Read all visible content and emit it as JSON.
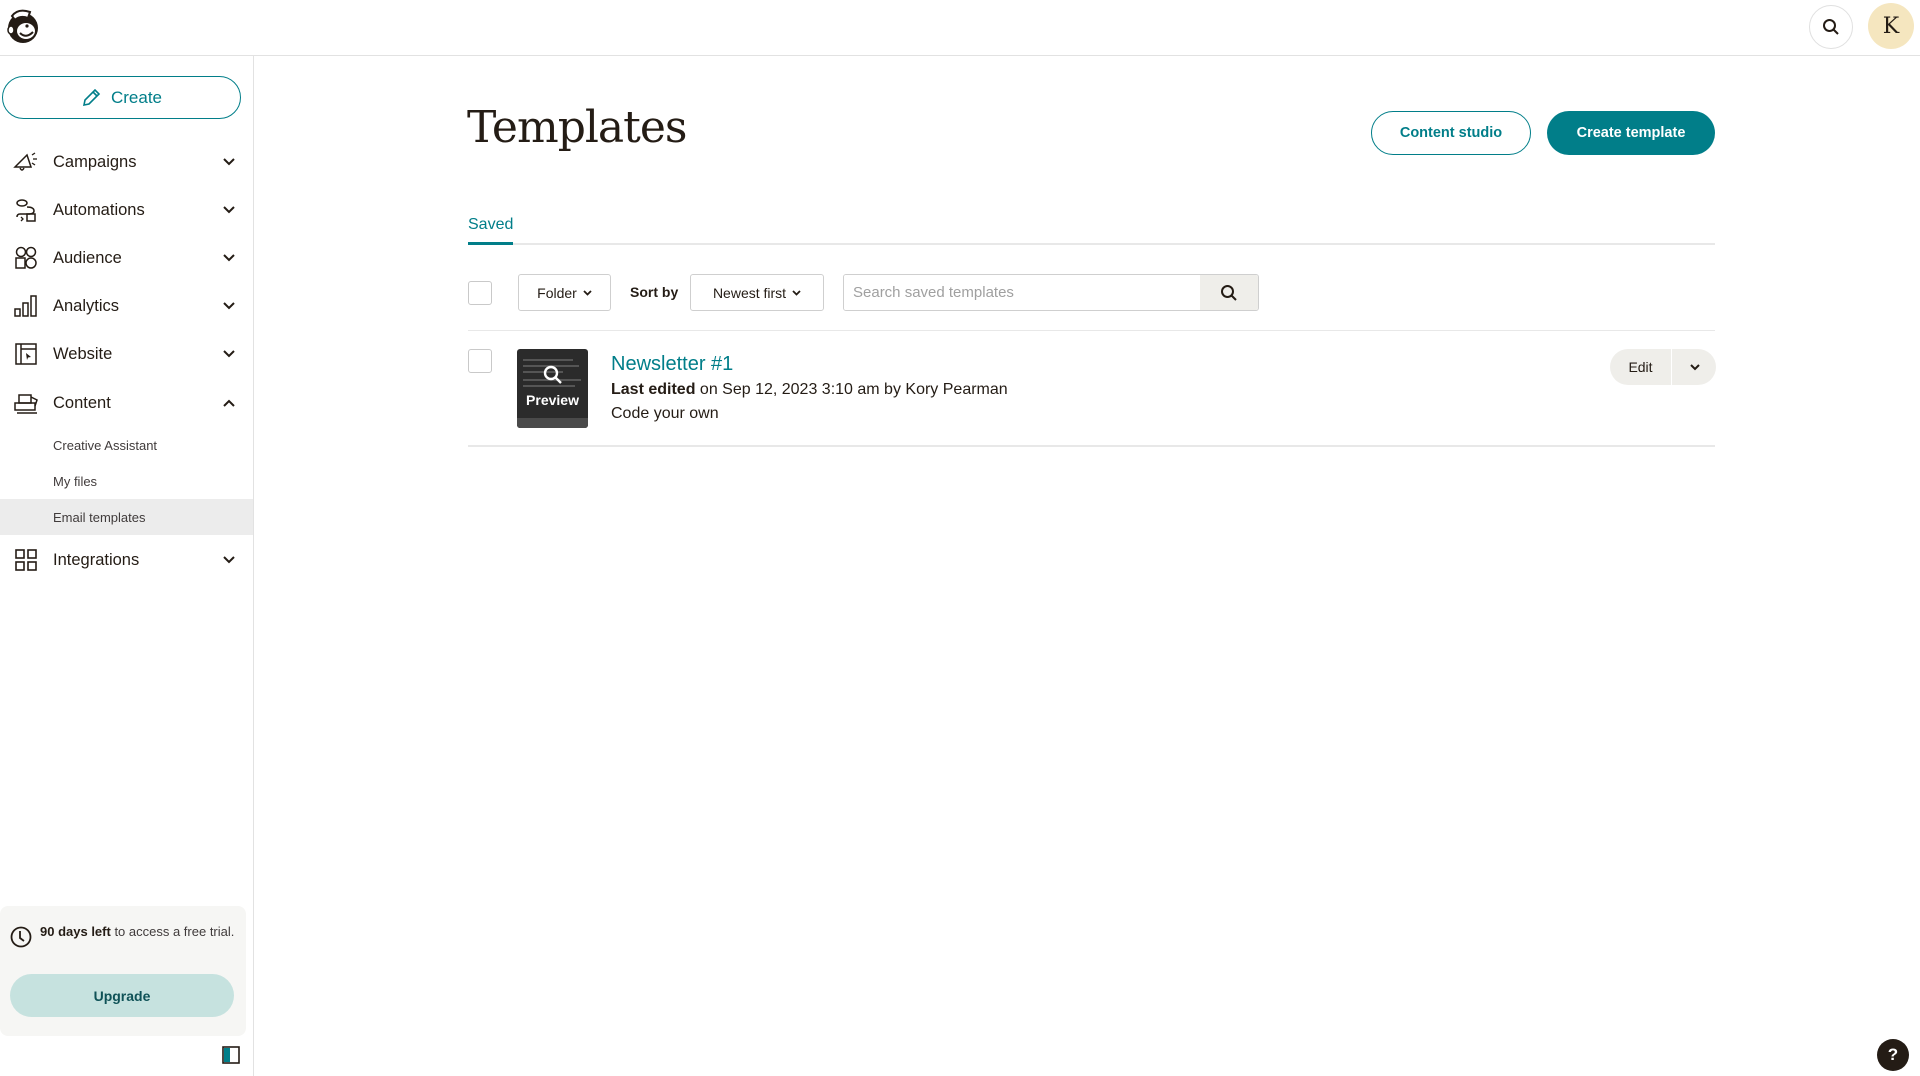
{
  "header": {
    "logo": "mailchimp-freddie-logo",
    "search_icon": "search-icon",
    "avatar_initial": "K"
  },
  "sidebar": {
    "create_label": "Create",
    "nav": [
      {
        "label": "Campaigns",
        "icon": "megaphone-icon",
        "expanded": false
      },
      {
        "label": "Automations",
        "icon": "automation-flow-icon",
        "expanded": false
      },
      {
        "label": "Audience",
        "icon": "audience-icon",
        "expanded": false
      },
      {
        "label": "Analytics",
        "icon": "bar-chart-icon",
        "expanded": false
      },
      {
        "label": "Website",
        "icon": "website-icon",
        "expanded": false
      },
      {
        "label": "Content",
        "icon": "content-icon",
        "expanded": true
      }
    ],
    "content_subitems": [
      {
        "label": "Creative Assistant",
        "active": false
      },
      {
        "label": "My files",
        "active": false
      },
      {
        "label": "Email templates",
        "active": true
      }
    ],
    "integrations": {
      "label": "Integrations",
      "icon": "grid-icon",
      "expanded": false
    },
    "trial": {
      "bold": "90 days left",
      "rest": " to access a free trial.",
      "upgrade_label": "Upgrade"
    }
  },
  "main": {
    "title": "Templates",
    "content_studio_label": "Content studio",
    "create_template_label": "Create template",
    "tabs": [
      {
        "label": "Saved",
        "active": true
      }
    ],
    "toolbar": {
      "folder_label": "Folder",
      "sort_by_label": "Sort by",
      "sort_value": "Newest first",
      "search_placeholder": "Search saved templates",
      "search_value": ""
    },
    "templates": [
      {
        "name": "Newsletter #1",
        "last_edited_label": "Last edited",
        "last_edited_rest": " on Sep 12, 2023 3:10 am by Kory Pearman",
        "type": "Code your own",
        "thumbnail_overlay": "Preview",
        "edit_label": "Edit"
      }
    ]
  },
  "help_label": "?",
  "colors": {
    "accent": "#017e89",
    "upgrade_bg": "#c6e2df",
    "active_nav_bg": "#ececec",
    "text": "#241c15"
  }
}
